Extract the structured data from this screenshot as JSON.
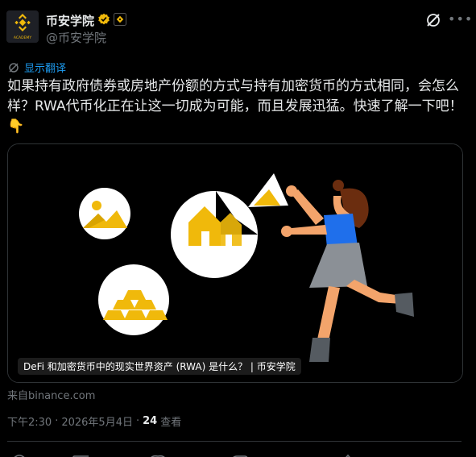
{
  "author": {
    "display_name": "币安学院",
    "handle": "@币安学院",
    "avatar_text": "ACADEMY",
    "verified_color": "#f0b90b"
  },
  "translate": {
    "label": "显示翻译"
  },
  "tweet": {
    "text": "如果持有政府债券或房地产份额的方式与持有加密货币的方式相同，会怎么样？RWA代币化正在让这一切成为可能，而且发展迅猛。快速了解一下吧！\n👇"
  },
  "card": {
    "caption": "DeFi 和加密货币中的现实世界资产 (RWA) 是什么？ | 币安学院",
    "source": "来自binance.com"
  },
  "meta": {
    "time": "下午2:30",
    "separator": "·",
    "date": "2026年5月4日",
    "views_count": "24",
    "views_label": "查看"
  },
  "colors": {
    "accent_yellow": "#f0b90b",
    "link_blue": "#1d9bf0",
    "muted": "#71767b"
  }
}
